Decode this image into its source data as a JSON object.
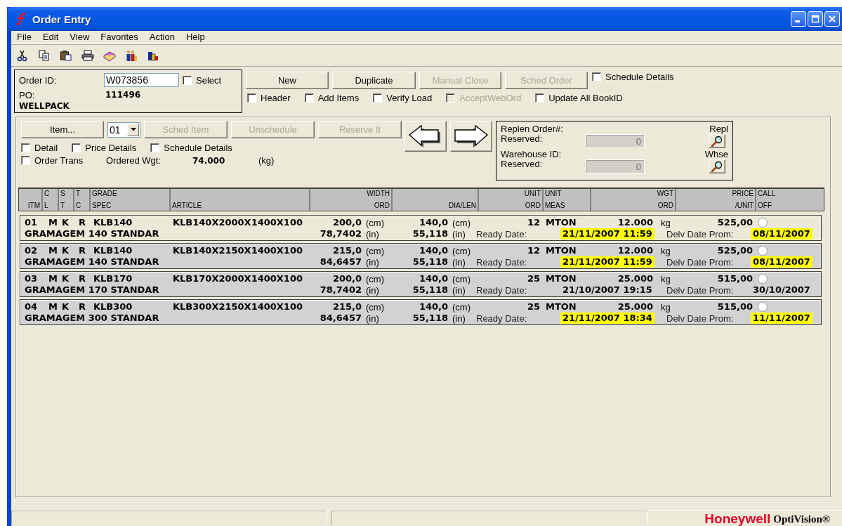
{
  "window": {
    "title": "Order Entry"
  },
  "menu": [
    "File",
    "Edit",
    "View",
    "Favorites",
    "Action",
    "Help"
  ],
  "order": {
    "id_label": "Order ID:",
    "id_value": "W073856",
    "select": {
      "label": "Select",
      "checked": false,
      "disabled": false
    },
    "po_label": "PO:",
    "po_value": "111496",
    "customer": "WELLPACK"
  },
  "order_buttons": [
    {
      "label": "New",
      "disabled": false
    },
    {
      "label": "Duplicate",
      "disabled": false
    },
    {
      "label": "Manual Close",
      "disabled": true
    },
    {
      "label": "Sched Order",
      "disabled": true
    }
  ],
  "schedule_details": {
    "label": "Schedule Details",
    "checked": false,
    "disabled": false
  },
  "order_options": [
    {
      "label": "Header",
      "checked": false,
      "disabled": false
    },
    {
      "label": "Add Items",
      "checked": false,
      "disabled": false
    },
    {
      "label": "Verify Load",
      "checked": false,
      "disabled": false
    },
    {
      "label": "AcceptWebOrd",
      "checked": false,
      "disabled": true
    },
    {
      "label": "Update All BookID",
      "checked": false,
      "disabled": false
    }
  ],
  "item_panel": {
    "item_button": "Item...",
    "item_number": "01",
    "buttons": [
      {
        "label": "Sched Item",
        "disabled": true
      },
      {
        "label": "Unschedule",
        "disabled": true
      },
      {
        "label": "Reserve It",
        "disabled": true
      }
    ],
    "options": [
      {
        "label": "Detail",
        "checked": false,
        "disabled": false
      },
      {
        "label": "Price Details",
        "checked": false,
        "disabled": false
      },
      {
        "label": "Schedule Details",
        "checked": false,
        "disabled": false
      }
    ],
    "order_trans": {
      "label": "Order Trans",
      "checked": false,
      "disabled": false
    },
    "ordered_wgt_label": "Ordered Wgt:",
    "ordered_wgt": "74.000",
    "ordered_wgt_unit": "(kg)"
  },
  "replen": {
    "order_label": "Replen Order#:",
    "reserved_label": "Reserved:",
    "reserved_value": "0",
    "repl_label": "Repl",
    "warehouse_label": "Warehouse ID:",
    "warehouse_reserved_label": "Reserved:",
    "warehouse_reserved_value": "0",
    "whse_label": "Whse"
  },
  "columns": [
    {
      "bottom": "ITM"
    },
    {
      "top": "C",
      "bottom": "L"
    },
    {
      "top": "S",
      "bottom": "T"
    },
    {
      "top": "T",
      "bottom": "C"
    },
    {
      "top": "GRADE",
      "bottom": "SPEC"
    },
    {
      "bottom": "ARTICLE"
    },
    {
      "top": "WIDTH",
      "bottom": "ORD"
    },
    {
      "bottom": "DIA/LEN"
    },
    {
      "top": "UNIT",
      "bottom": "ORD"
    },
    {
      "top": "UNIT",
      "bottom": "MEAS"
    },
    {
      "top": "WGT",
      "bottom": "ORD"
    },
    {
      "top": "PRICE",
      "bottom": "/UNIT"
    },
    {
      "top": "CALL",
      "bottom": "OFF"
    }
  ],
  "rows": [
    {
      "selected": true,
      "itm": "01",
      "cl": "M",
      "st": "K",
      "tc": "R",
      "grade": "KLB140",
      "article": "KLB140X2000X1400X100",
      "width_cm": "200,0",
      "width_cm_unit": "(cm)",
      "dia_cm": "140,0",
      "dia_cm_unit": "(cm)",
      "unit_ord": "12",
      "unit_meas": "MTON",
      "wgt": "12.000",
      "wgt_unit": "kg",
      "price": "525,00",
      "call_off": false,
      "spec": "GRAMAGEM 140 STANDAR",
      "width_in": "78,7402",
      "width_in_unit": "(in)",
      "dia_in": "55,118",
      "dia_in_unit": "(in)",
      "ready_label": "Ready Date:",
      "ready_date": "21/11/2007 11:59",
      "ready_flagged": true,
      "delv_label": "Delv Date Prom:",
      "delv_date": "08/11/2007",
      "delv_flagged": true
    },
    {
      "selected": false,
      "itm": "02",
      "cl": "M",
      "st": "K",
      "tc": "R",
      "grade": "KLB140",
      "article": "KLB140X2150X1400X100",
      "width_cm": "215,0",
      "width_cm_unit": "(cm)",
      "dia_cm": "140,0",
      "dia_cm_unit": "(cm)",
      "unit_ord": "12",
      "unit_meas": "MTON",
      "wgt": "12.000",
      "wgt_unit": "kg",
      "price": "525,00",
      "call_off": false,
      "spec": "GRAMAGEM 140 STANDAR",
      "width_in": "84,6457",
      "width_in_unit": "(in)",
      "dia_in": "55,118",
      "dia_in_unit": "(in)",
      "ready_label": "Ready Date:",
      "ready_date": "21/11/2007 11:59",
      "ready_flagged": true,
      "delv_label": "Delv Date Prom:",
      "delv_date": "08/11/2007",
      "delv_flagged": true
    },
    {
      "selected": false,
      "itm": "03",
      "cl": "M",
      "st": "K",
      "tc": "R",
      "grade": "KLB170",
      "article": "KLB170X2000X1400X100",
      "width_cm": "200,0",
      "width_cm_unit": "(cm)",
      "dia_cm": "140,0",
      "dia_cm_unit": "(cm)",
      "unit_ord": "25",
      "unit_meas": "MTON",
      "wgt": "25.000",
      "wgt_unit": "kg",
      "price": "515,00",
      "call_off": false,
      "spec": "GRAMAGEM 170 STANDAR",
      "width_in": "78,7402",
      "width_in_unit": "(in)",
      "dia_in": "55,118",
      "dia_in_unit": "(in)",
      "ready_label": "Ready Date:",
      "ready_date": "21/10/2007 19:15",
      "ready_flagged": false,
      "delv_label": "Delv Date Prom:",
      "delv_date": "30/10/2007",
      "delv_flagged": false
    },
    {
      "selected": false,
      "itm": "04",
      "cl": "M",
      "st": "K",
      "tc": "R",
      "grade": "KLB300",
      "article": "KLB300X2150X1400X100",
      "width_cm": "215,0",
      "width_cm_unit": "(cm)",
      "dia_cm": "140,0",
      "dia_cm_unit": "(cm)",
      "unit_ord": "25",
      "unit_meas": "MTON",
      "wgt": "25.000",
      "wgt_unit": "kg",
      "price": "515,00",
      "call_off": false,
      "spec": "GRAMAGEM 300 STANDAR",
      "width_in": "84,6457",
      "width_in_unit": "(in)",
      "dia_in": "55,118",
      "dia_in_unit": "(in)",
      "ready_label": "Ready Date:",
      "ready_date": "21/11/2007 18:34",
      "ready_flagged": true,
      "delv_label": "Delv Date Prom:",
      "delv_date": "11/11/2007",
      "delv_flagged": true
    }
  ],
  "brand": {
    "name": "Honeywell",
    "product": "OptiVision®"
  }
}
